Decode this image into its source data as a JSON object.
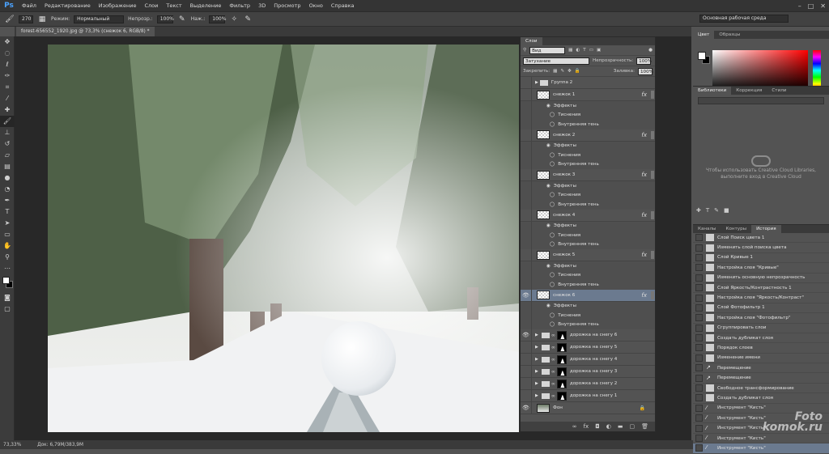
{
  "menu": {
    "logo": "Ps",
    "items": [
      "Файл",
      "Редактирование",
      "Изображение",
      "Слои",
      "Текст",
      "Выделение",
      "Фильтр",
      "3D",
      "Просмотр",
      "Окно",
      "Справка"
    ],
    "window_controls": [
      "–",
      "□",
      "✕"
    ]
  },
  "options": {
    "brush_size": "270",
    "mode_label": "Режим:",
    "mode_value": "Нормальный",
    "opacity_label": "Непрозр.:",
    "opacity_value": "100%",
    "flow_label": "Наж.:",
    "flow_value": "100%",
    "workspace": "Основная рабочая среда"
  },
  "document": {
    "tab": "forest-656552_1920.jpg @ 73,3% (снежок 6, RGB/8) *",
    "zoom": "73,33%",
    "doc_info": "Док: 6,79M/383,9M"
  },
  "layers_panel": {
    "title": "Слои",
    "filter_kind": "Вид",
    "blend_mode": "Затухание",
    "opacity_label": "Непрозрачность:",
    "opacity_value": "100%",
    "lock_label": "Закрепить:",
    "fill_label": "Заливка:",
    "fill_value": "100%",
    "layers": [
      {
        "name": "Группа 2",
        "type": "group",
        "visible": false
      },
      {
        "name": "снежок 1",
        "type": "layer",
        "visible": false,
        "fx": true
      },
      {
        "name": "Эффекты",
        "type": "sub"
      },
      {
        "name": "Тиснения",
        "type": "sub2"
      },
      {
        "name": "Внутренняя тень",
        "type": "sub2"
      },
      {
        "name": "снежок 2",
        "type": "layer",
        "visible": false,
        "fx": true
      },
      {
        "name": "Эффекты",
        "type": "sub"
      },
      {
        "name": "Тиснения",
        "type": "sub2"
      },
      {
        "name": "Внутренняя тень",
        "type": "sub2"
      },
      {
        "name": "снежок 3",
        "type": "layer",
        "visible": false,
        "fx": true
      },
      {
        "name": "Эффекты",
        "type": "sub"
      },
      {
        "name": "Тиснения",
        "type": "sub2"
      },
      {
        "name": "Внутренняя тень",
        "type": "sub2"
      },
      {
        "name": "снежок 4",
        "type": "layer",
        "visible": false,
        "fx": true
      },
      {
        "name": "Эффекты",
        "type": "sub"
      },
      {
        "name": "Тиснения",
        "type": "sub2"
      },
      {
        "name": "Внутренняя тень",
        "type": "sub2"
      },
      {
        "name": "снежок 5",
        "type": "layer",
        "visible": false,
        "fx": true
      },
      {
        "name": "Эффекты",
        "type": "sub"
      },
      {
        "name": "Тиснения",
        "type": "sub2"
      },
      {
        "name": "Внутренняя тень",
        "type": "sub2"
      },
      {
        "name": "снежок 6",
        "type": "layer",
        "visible": true,
        "fx": true,
        "selected": true
      },
      {
        "name": "Эффекты",
        "type": "sub"
      },
      {
        "name": "Тиснения",
        "type": "sub2"
      },
      {
        "name": "Внутренняя тень",
        "type": "sub2"
      },
      {
        "name": "дорожка на снегу 6",
        "type": "adj",
        "visible": true
      },
      {
        "name": "дорожка на снегу 5",
        "type": "adj",
        "visible": false
      },
      {
        "name": "дорожка на снегу 4",
        "type": "adj",
        "visible": false
      },
      {
        "name": "дорожка на снегу 3",
        "type": "adj",
        "visible": false
      },
      {
        "name": "дорожка на снегу 2",
        "type": "adj",
        "visible": false
      },
      {
        "name": "дорожка на снегу 1",
        "type": "adj",
        "visible": false
      },
      {
        "name": "Фон",
        "type": "bg",
        "visible": true
      }
    ]
  },
  "right_dock": {
    "color_tabs": [
      "Цвет",
      "Образцы"
    ],
    "lib_tabs": [
      "Библиотеки",
      "Коррекция",
      "Стили"
    ],
    "lib_message": "Чтобы использовать Creative Cloud Libraries, выполните вход в Creative Cloud",
    "history_tabs": [
      "Каналы",
      "Контуры",
      "История"
    ],
    "history": [
      {
        "label": "Слой Поиск цвета 1",
        "icon": "doc"
      },
      {
        "label": "Изменить слой поиска цвета",
        "icon": "doc"
      },
      {
        "label": "Слой Кривые 1",
        "icon": "doc"
      },
      {
        "label": "Настройка слоя \"Кривые\"",
        "icon": "doc"
      },
      {
        "label": "Изменить основную непрозрачность",
        "icon": "doc"
      },
      {
        "label": "Слой Яркость/Контрастность 1",
        "icon": "doc"
      },
      {
        "label": "Настройка слоя \"Яркость/Контраст\"",
        "icon": "doc"
      },
      {
        "label": "Слой Фотофильтр 1",
        "icon": "doc"
      },
      {
        "label": "Настройка слоя \"Фотофильтр\"",
        "icon": "doc"
      },
      {
        "label": "Сгруппировать слои",
        "icon": "doc"
      },
      {
        "label": "Создать дубликат слоя",
        "icon": "doc"
      },
      {
        "label": "Порядок слоев",
        "icon": "doc"
      },
      {
        "label": "Изменение имени",
        "icon": "doc"
      },
      {
        "label": "Перемещение",
        "icon": "move"
      },
      {
        "label": "Перемещение",
        "icon": "move"
      },
      {
        "label": "Свободное трансформирование",
        "icon": "doc"
      },
      {
        "label": "Создать дубликат слоя",
        "icon": "doc"
      },
      {
        "label": "Инструмент \"Кисть\"",
        "icon": "brush"
      },
      {
        "label": "Инструмент \"Кисть\"",
        "icon": "brush"
      },
      {
        "label": "Инструмент \"Кисть\"",
        "icon": "brush"
      },
      {
        "label": "Инструмент \"Кисть\"",
        "icon": "brush"
      },
      {
        "label": "Инструмент \"Кисть\"",
        "icon": "brush",
        "active": true
      }
    ],
    "watermark": [
      "Foto",
      "komok.ru"
    ]
  }
}
